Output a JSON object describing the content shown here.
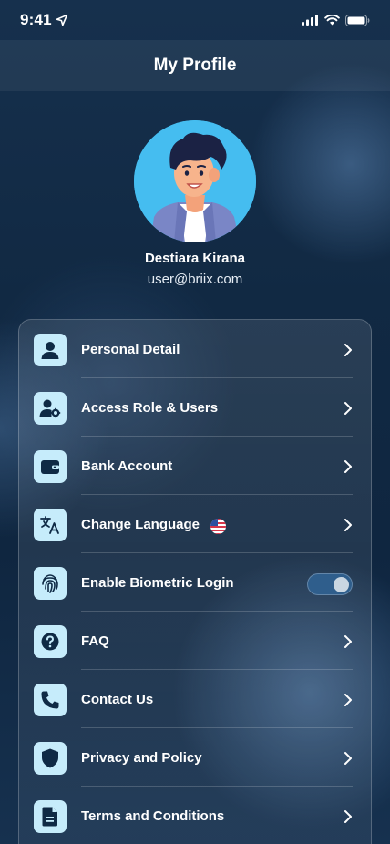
{
  "status_bar": {
    "time": "9:41"
  },
  "header": {
    "title": "My Profile"
  },
  "profile": {
    "name": "Destiara Kirana",
    "email": "user@briix.com"
  },
  "menu": {
    "items": [
      {
        "label": "Personal Detail",
        "icon": "person-icon"
      },
      {
        "label": "Access Role & Users",
        "icon": "user-gear-icon"
      },
      {
        "label": "Bank Account",
        "icon": "wallet-icon"
      },
      {
        "label": "Change Language",
        "icon": "translate-icon",
        "flag": "us-flag-icon"
      },
      {
        "label": "Enable Biometric Login",
        "icon": "fingerprint-icon",
        "toggle_on": true
      },
      {
        "label": "FAQ",
        "icon": "question-icon"
      },
      {
        "label": "Contact Us",
        "icon": "phone-icon"
      },
      {
        "label": "Privacy and Policy",
        "icon": "shield-icon"
      },
      {
        "label": "Terms and Conditions",
        "icon": "document-icon"
      }
    ]
  },
  "colors": {
    "background": "#112943",
    "icon_tile": "#c6ecfb",
    "icon_glyph": "#0f2a45",
    "avatar_bg": "#45bdf0",
    "toggle_track": "#2f5e8c"
  }
}
